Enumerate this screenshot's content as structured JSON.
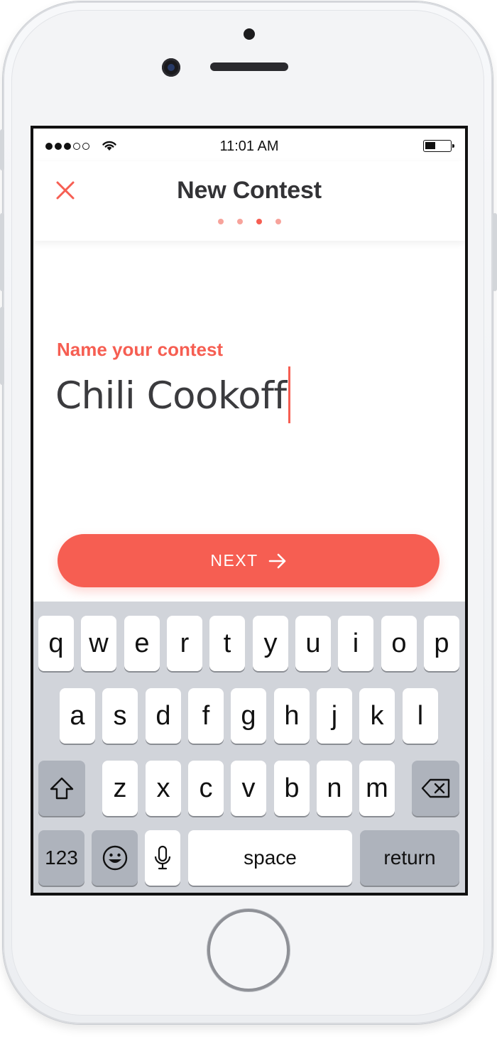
{
  "status_bar": {
    "time": "11:01 AM"
  },
  "header": {
    "title": "New Contest",
    "step_total": 4,
    "step_current": 3,
    "close_icon": "close-icon"
  },
  "form": {
    "label": "Name your contest",
    "value": "Chili Cookoff"
  },
  "next_button": {
    "label": "NEXT",
    "icon": "arrow-right-icon"
  },
  "keyboard": {
    "row1": [
      "q",
      "w",
      "e",
      "r",
      "t",
      "y",
      "u",
      "i",
      "o",
      "p"
    ],
    "row2": [
      "a",
      "s",
      "d",
      "f",
      "g",
      "h",
      "j",
      "k",
      "l"
    ],
    "row3": [
      "z",
      "x",
      "c",
      "v",
      "b",
      "n",
      "m"
    ],
    "numbers_label": "123",
    "space_label": "space",
    "return_label": "return"
  },
  "colors": {
    "accent": "#f65e52",
    "accent_light": "#f7a39b",
    "keyboard_bg": "#d1d4da",
    "title": "#333336"
  }
}
